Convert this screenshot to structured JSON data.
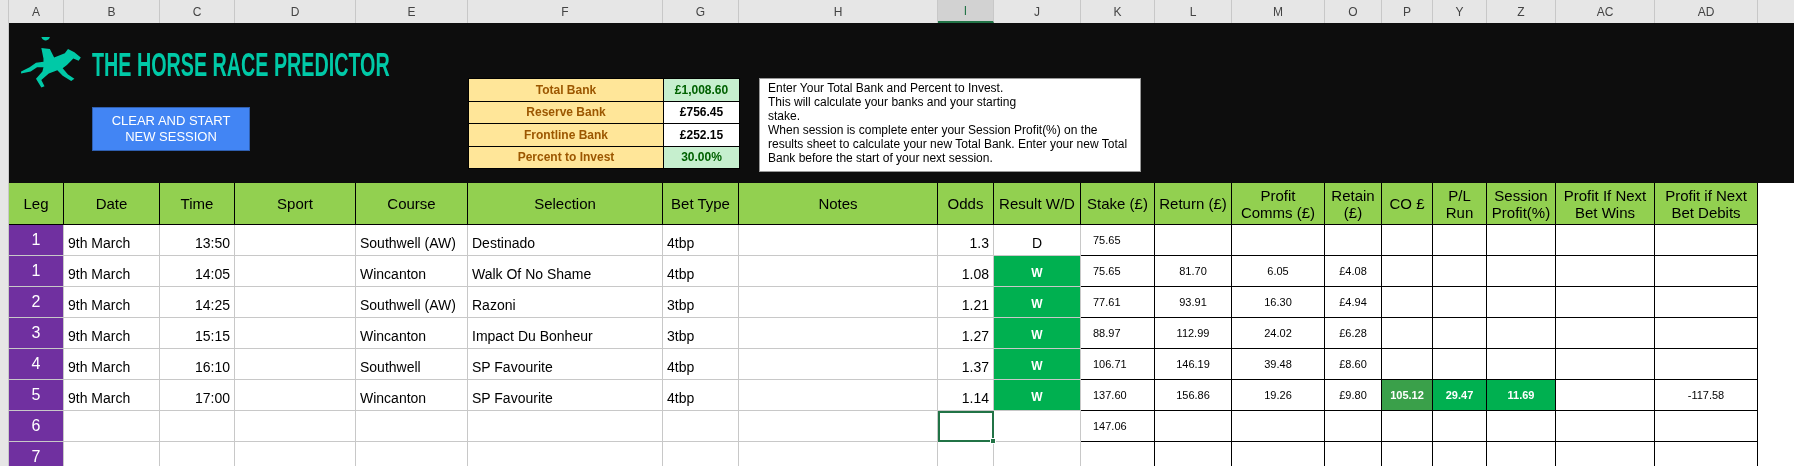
{
  "column_letters": [
    {
      "label": "A",
      "selected": false
    },
    {
      "label": "B",
      "selected": false
    },
    {
      "label": "C",
      "selected": false
    },
    {
      "label": "D",
      "selected": false
    },
    {
      "label": "E",
      "selected": false
    },
    {
      "label": "F",
      "selected": false
    },
    {
      "label": "G",
      "selected": false
    },
    {
      "label": "H",
      "selected": false
    },
    {
      "label": "I",
      "selected": true
    },
    {
      "label": "J",
      "selected": false
    },
    {
      "label": "K",
      "selected": false
    },
    {
      "label": "L",
      "selected": false
    },
    {
      "label": "M",
      "selected": false
    },
    {
      "label": "O",
      "selected": false
    },
    {
      "label": "P",
      "selected": false
    },
    {
      "label": "Y",
      "selected": false
    },
    {
      "label": "Z",
      "selected": false
    },
    {
      "label": "AC",
      "selected": false
    },
    {
      "label": "AD",
      "selected": false
    }
  ],
  "title": "THE HORSE RACE PREDICTOR",
  "clear_button": "CLEAR AND START NEW SESSION",
  "bank": [
    {
      "label": "Total Bank",
      "value": "£1,008.60",
      "highlight": true
    },
    {
      "label": "Reserve Bank",
      "value": "£756.45",
      "highlight": false
    },
    {
      "label": "Frontline Bank",
      "value": "£252.15",
      "highlight": false
    },
    {
      "label": "Percent to Invest",
      "value": "30.00%",
      "highlight": true
    }
  ],
  "instructions": [
    "Enter Your Total Bank and Percent to Invest.",
    "This will calculate your banks and your starting",
    "stake.",
    "When session is complete enter your Session Profit(%) on the results sheet to calculate your new Total Bank. Enter your new Total Bank before the start of your next session."
  ],
  "table": {
    "columns": [
      "Leg",
      "Date",
      "Time",
      "Sport",
      "Course",
      "Selection",
      "Bet Type",
      "Notes",
      "Odds",
      "Result W/D",
      "Stake (£)",
      "Return (£)",
      "Profit Comms (£)",
      "Retain (£)",
      "CO £",
      "P/L Run",
      "Session Profit(%)",
      "Profit If Next Bet Wins",
      "Profit if Next Bet Debits"
    ],
    "rows": [
      {
        "leg": "1",
        "date": "9th March",
        "time": "13:50",
        "course": "Southwell (AW)",
        "selection": "Destinado",
        "bet_type": "4tbp",
        "odds": "1.3",
        "result": "D",
        "won": false,
        "stake": "75.65",
        "active": false,
        "totals_highlight": false
      },
      {
        "leg": "1",
        "date": "9th March",
        "time": "14:05",
        "course": "Wincanton",
        "selection": "Walk Of No Shame",
        "bet_type": "4tbp",
        "odds": "1.08",
        "result": "W",
        "won": true,
        "stake": "75.65",
        "return": "81.70",
        "profit_comms": "6.05",
        "retain": "£4.08",
        "active": false,
        "totals_highlight": false
      },
      {
        "leg": "2",
        "date": "9th March",
        "time": "14:25",
        "course": "Southwell (AW)",
        "selection": "Razoni",
        "bet_type": "3tbp",
        "odds": "1.21",
        "result": "W",
        "won": true,
        "stake": "77.61",
        "return": "93.91",
        "profit_comms": "16.30",
        "retain": "£4.94",
        "active": false,
        "totals_highlight": false
      },
      {
        "leg": "3",
        "date": "9th March",
        "time": "15:15",
        "course": "Wincanton",
        "selection": "Impact Du Bonheur",
        "bet_type": "3tbp",
        "odds": "1.27",
        "result": "W",
        "won": true,
        "stake": "88.97",
        "return": "112.99",
        "profit_comms": "24.02",
        "retain": "£6.28",
        "active": false,
        "totals_highlight": false
      },
      {
        "leg": "4",
        "date": "9th March",
        "time": "16:10",
        "course": "Southwell",
        "selection": "SP Favourite",
        "bet_type": "4tbp",
        "odds": "1.37",
        "result": "W",
        "won": true,
        "stake": "106.71",
        "return": "146.19",
        "profit_comms": "39.48",
        "retain": "£8.60",
        "active": false,
        "totals_highlight": false
      },
      {
        "leg": "5",
        "date": "9th March",
        "time": "17:00",
        "course": "Wincanton",
        "selection": "SP Favourite",
        "bet_type": "4tbp",
        "odds": "1.14",
        "result": "W",
        "won": true,
        "stake": "137.60",
        "return": "156.86",
        "profit_comms": "19.26",
        "retain": "£9.80",
        "co": "105.12",
        "pl_run": "29.47",
        "session_profit": "11.69",
        "profit_if_next_debits": "-117.58",
        "active": false,
        "totals_highlight": true
      },
      {
        "leg": "6",
        "stake": "147.06",
        "active": true,
        "totals_highlight": false
      },
      {
        "leg": "7",
        "active": false,
        "totals_highlight": false
      }
    ]
  }
}
